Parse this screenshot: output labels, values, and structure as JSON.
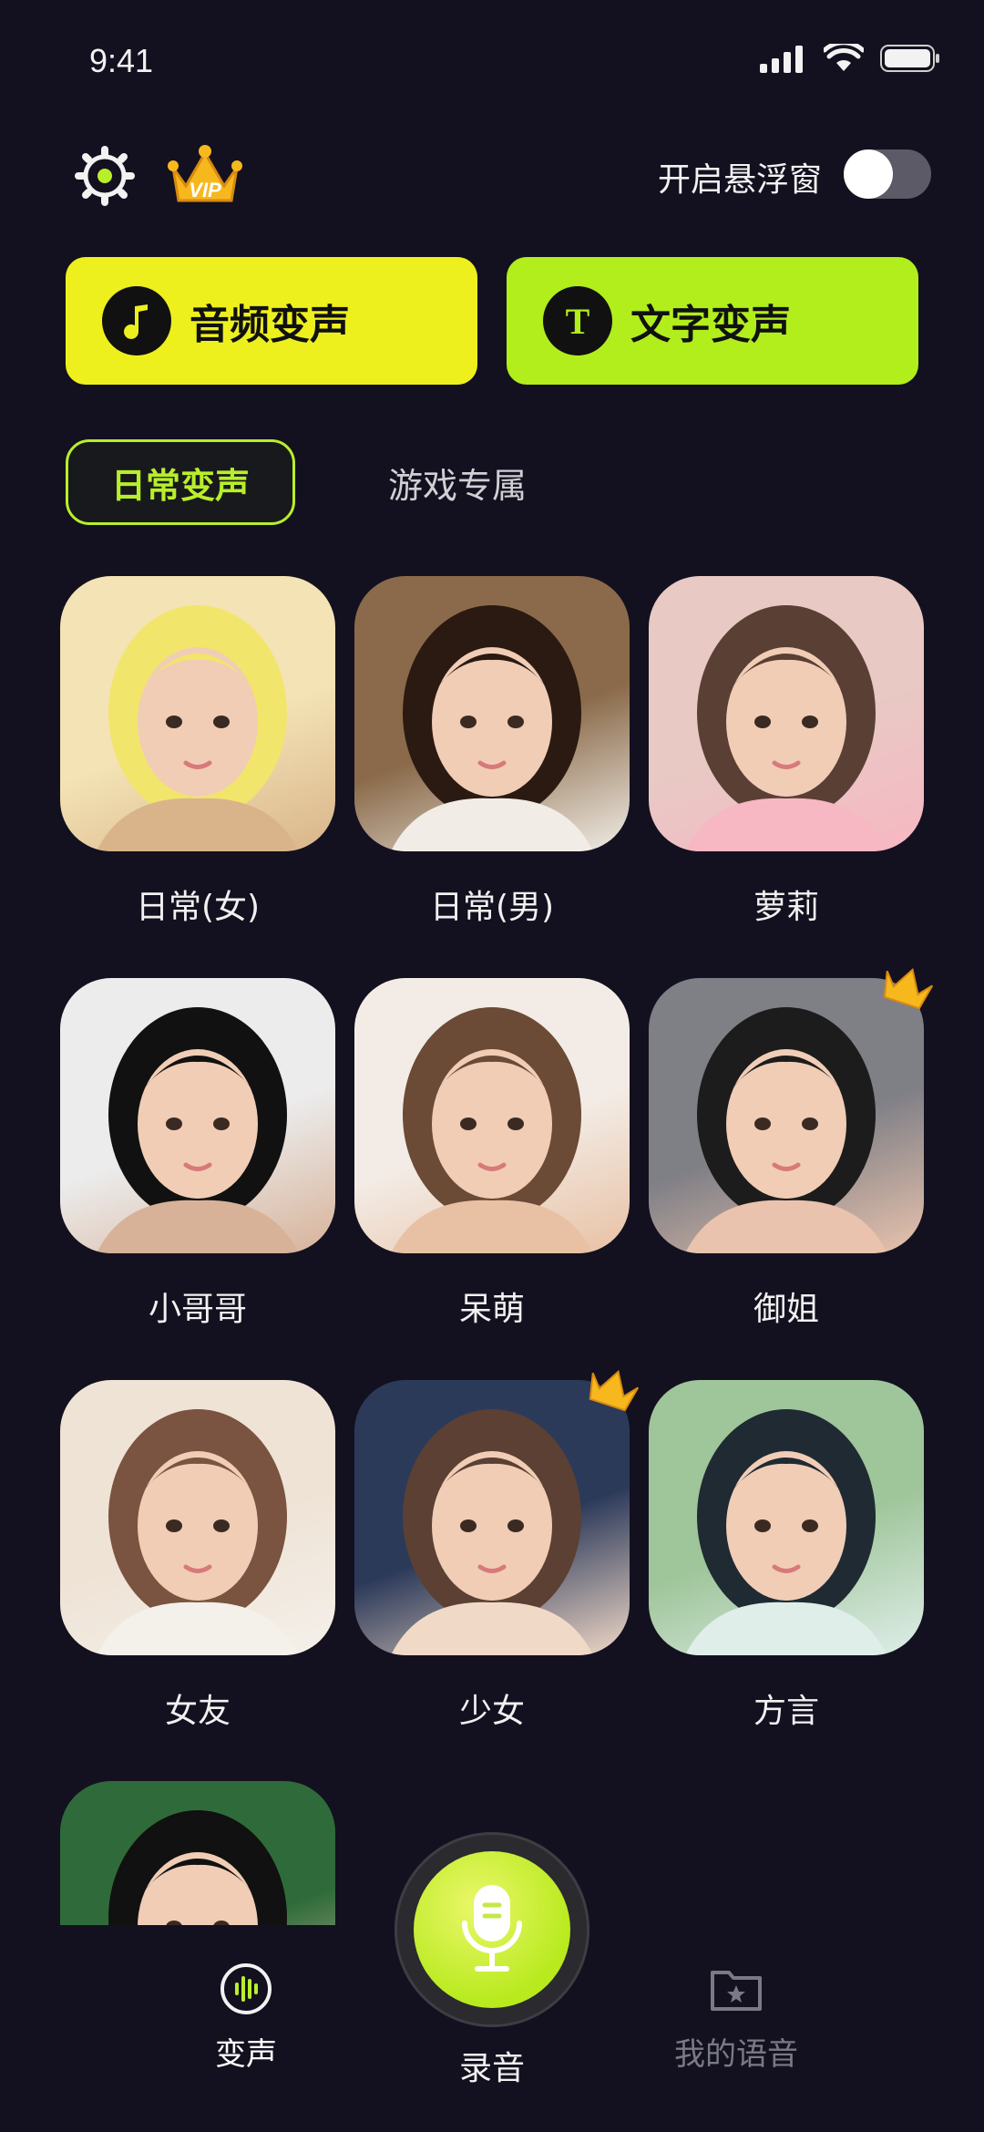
{
  "status_bar": {
    "time": "9:41"
  },
  "header": {
    "floating_window_label": "开启悬浮窗",
    "floating_window_on": false
  },
  "actions": {
    "audio_change": "音频变声",
    "text_change": "文字变声"
  },
  "tabs": [
    {
      "label": "日常变声",
      "active": true
    },
    {
      "label": "游戏专属",
      "active": false
    }
  ],
  "voices": [
    {
      "name": "日常(女)",
      "vip": false,
      "palette": [
        "#f3e3b5",
        "#d9b48a",
        "#f2e56b"
      ]
    },
    {
      "name": "日常(男)",
      "vip": false,
      "palette": [
        "#8a6a4a",
        "#f1ede6",
        "#2a1a12"
      ]
    },
    {
      "name": "萝莉",
      "vip": false,
      "palette": [
        "#e8c9c4",
        "#f7b7c3",
        "#5a3f35"
      ]
    },
    {
      "name": "小哥哥",
      "vip": false,
      "palette": [
        "#ececec",
        "#d7b299",
        "#111111"
      ]
    },
    {
      "name": "呆萌",
      "vip": false,
      "palette": [
        "#f3ece6",
        "#e8c1a4",
        "#6b4a36"
      ]
    },
    {
      "name": "御姐",
      "vip": true,
      "palette": [
        "#7f7f86",
        "#e9c3ad",
        "#1c1c1c"
      ]
    },
    {
      "name": "女友",
      "vip": false,
      "palette": [
        "#efe3d6",
        "#f4f0ea",
        "#7a5440"
      ]
    },
    {
      "name": "少女",
      "vip": true,
      "palette": [
        "#2c3a5a",
        "#f1d9c8",
        "#5b4033"
      ]
    },
    {
      "name": "方言",
      "vip": false,
      "palette": [
        "#9fc59a",
        "#dfeee9",
        "#1f2a33"
      ]
    },
    {
      "name": "",
      "vip": false,
      "palette": [
        "#2f6b3a",
        "#e8c6ab",
        "#111111"
      ]
    }
  ],
  "bottom_nav": {
    "voice_label": "变声",
    "record_label": "录音",
    "mine_label": "我的语音"
  }
}
